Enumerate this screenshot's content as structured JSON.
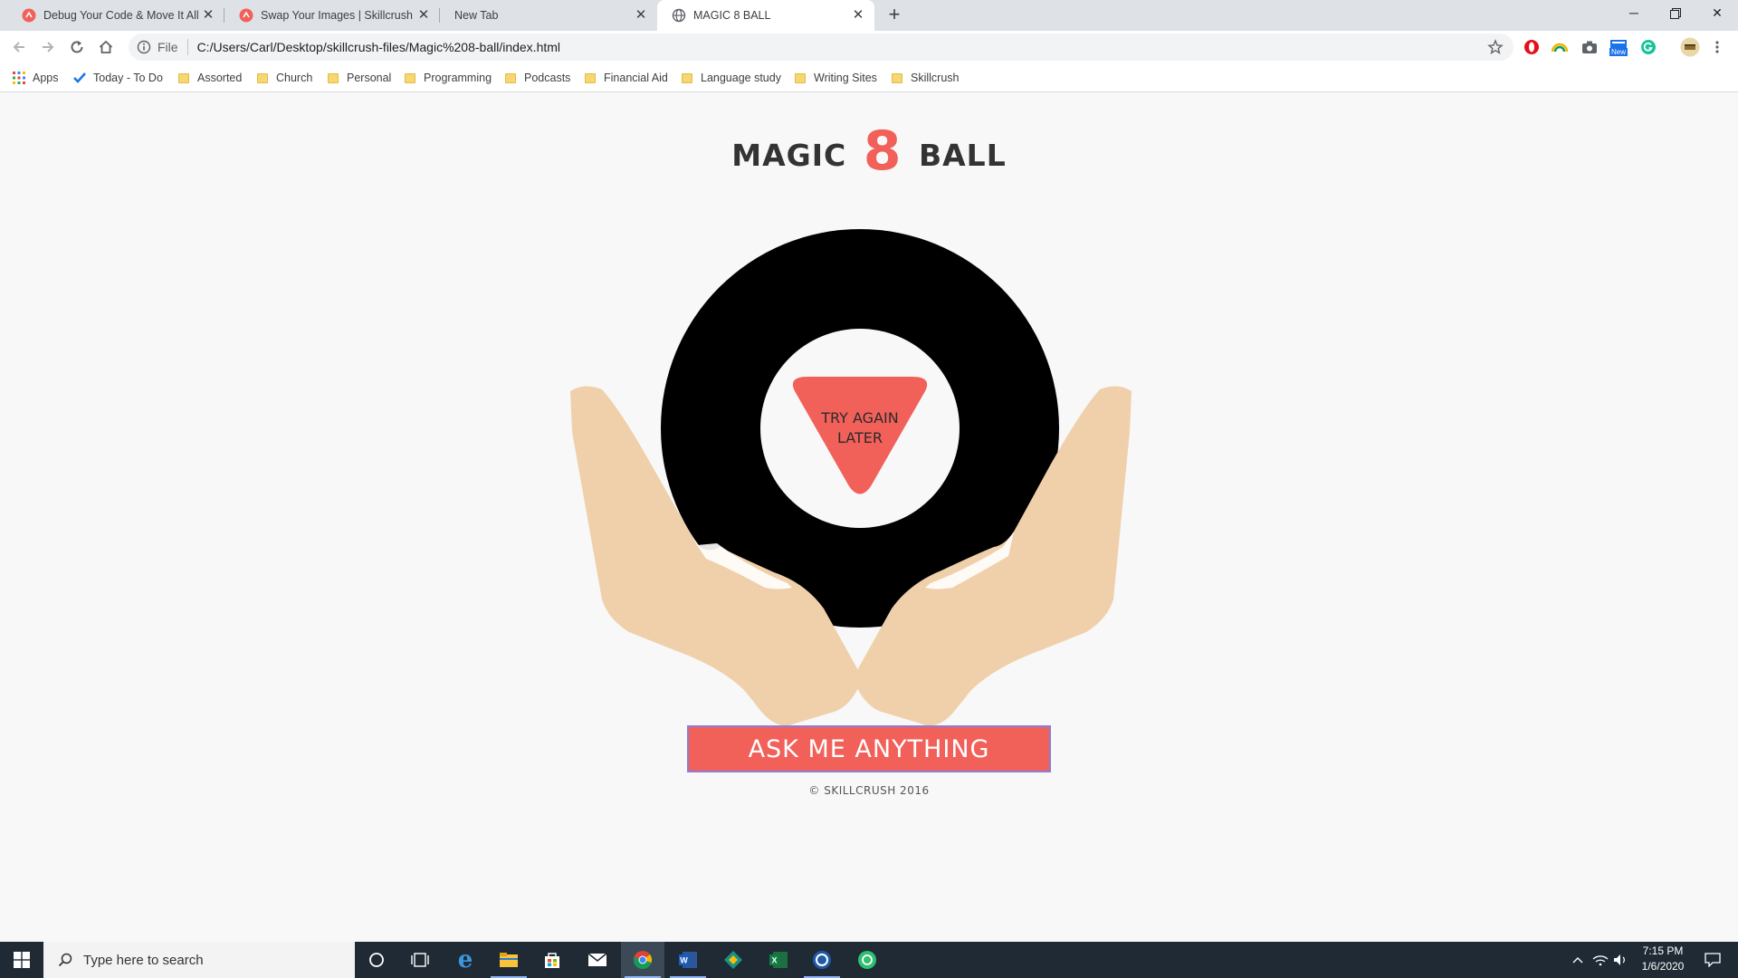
{
  "browser": {
    "tabs": [
      {
        "title": "Debug Your Code & Move It All t",
        "icon": "skillcrush-icon"
      },
      {
        "title": "Swap Your Images | Skillcrush",
        "icon": "skillcrush-icon"
      },
      {
        "title": "New Tab",
        "icon": ""
      },
      {
        "title": "MAGIC 8 BALL",
        "icon": "globe-icon"
      }
    ],
    "new_tab_symbol": "+",
    "address": {
      "scheme_label": "File",
      "url": "C:/Users/Carl/Desktop/skillcrush-files/Magic%208-ball/index.html"
    },
    "extensions": [
      "opera-icon",
      "rainbow-icon",
      "camera-icon",
      "news-icon",
      "grammarly-icon",
      "profile-avatar"
    ],
    "extension_badge": "New",
    "bookmarks": [
      {
        "label": "Apps",
        "icon": "apps-grid-icon"
      },
      {
        "label": "Today - To Do",
        "icon": "checkmark-icon"
      },
      {
        "label": "Assorted",
        "icon": "folder-icon"
      },
      {
        "label": "Church",
        "icon": "folder-icon"
      },
      {
        "label": "Personal",
        "icon": "folder-icon"
      },
      {
        "label": "Programming",
        "icon": "folder-icon"
      },
      {
        "label": "Podcasts",
        "icon": "folder-icon"
      },
      {
        "label": "Financial Aid",
        "icon": "folder-icon"
      },
      {
        "label": "Language study",
        "icon": "folder-icon"
      },
      {
        "label": "Writing Sites",
        "icon": "folder-icon"
      },
      {
        "label": "Skillcrush",
        "icon": "folder-icon"
      }
    ]
  },
  "page": {
    "title_before": "MAGIC",
    "title_number": "8",
    "title_after": "BALL",
    "answer_line1": "TRY AGAIN",
    "answer_line2": "LATER",
    "button_label": "ASK ME ANYTHING",
    "footer": "© SKILLCRUSH 2016",
    "colors": {
      "accent": "#f2605a",
      "ball": "#000000",
      "hands": "#f0d0aa",
      "background": "#f8f8f8"
    }
  },
  "taskbar": {
    "search_placeholder": "Type here to search",
    "time": "7:15 PM",
    "date": "1/6/2020",
    "apps": [
      "cortana-icon",
      "task-view-icon",
      "edge-icon",
      "file-explorer-icon",
      "store-icon",
      "mail-icon",
      "chrome-icon",
      "word-icon",
      "gitkraken-icon",
      "excel-icon",
      "app-icon",
      "spotify-like-icon"
    ]
  }
}
